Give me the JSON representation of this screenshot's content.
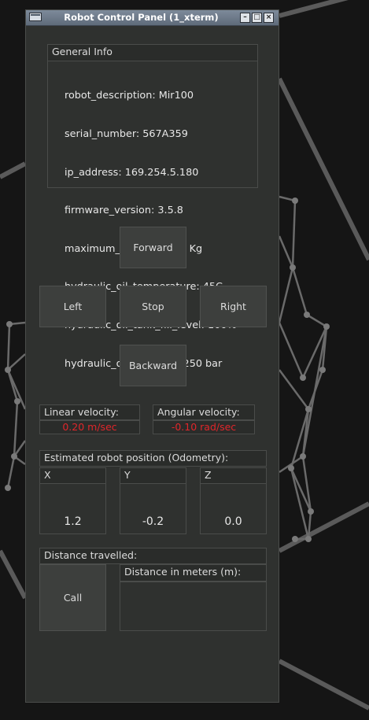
{
  "window": {
    "title": "Robot Control Panel (1_xterm)",
    "buttons": [
      "minimize",
      "maximize",
      "close"
    ]
  },
  "general_info": {
    "label": "General Info",
    "lines": [
      "robot_description: Mir100",
      "serial_number: 567A359",
      "ip_address: 169.254.5.180",
      "firmware_version: 3.5.8",
      "maximum_payload: 100 Kg",
      "hydraulic_oil_temperature: 45C",
      "hydraulic_oil_tank_fill_level: 100%",
      "hydraulic_oil_pressure: 250 bar"
    ]
  },
  "controls": {
    "forward": "Forward",
    "left": "Left",
    "stop": "Stop",
    "right": "Right",
    "backward": "Backward"
  },
  "velocity": {
    "linear_label": "Linear velocity:",
    "linear_value": "0.20 m/sec",
    "angular_label": "Angular velocity:",
    "angular_value": "-0.10 rad/sec",
    "value_color": "#e0262a"
  },
  "odometry": {
    "label": "Estimated robot position (Odometry):",
    "x_label": "X",
    "x_value": "1.2",
    "y_label": "Y",
    "y_value": "-0.2",
    "z_label": "Z",
    "z_value": "0.0"
  },
  "distance": {
    "label": "Distance travelled:",
    "call_button": "Call",
    "meters_label": "Distance in meters (m):",
    "meters_value": ""
  }
}
